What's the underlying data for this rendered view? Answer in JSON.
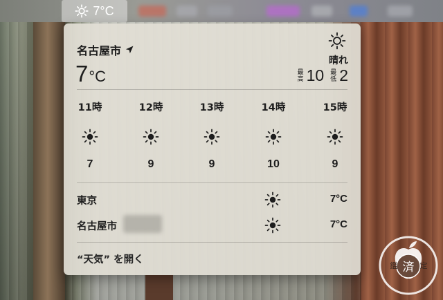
{
  "menubar": {
    "weather_temp": "7°C",
    "weather_icon": "sun-icon"
  },
  "panel": {
    "city": "名古屋市",
    "location_icon": "location-arrow-icon",
    "current_temp": "7",
    "current_unit": "°C",
    "condition": "晴れ",
    "condition_icon": "sun-icon",
    "high_label": [
      "最",
      "高"
    ],
    "high": "10",
    "low_label": [
      "最",
      "低"
    ],
    "low": "2",
    "hourly": [
      {
        "time": "11時",
        "icon": "sun-icon",
        "temp": "7"
      },
      {
        "time": "12時",
        "icon": "sun-icon",
        "temp": "9"
      },
      {
        "time": "13時",
        "icon": "sun-icon",
        "temp": "9"
      },
      {
        "time": "14時",
        "icon": "sun-icon",
        "temp": "10"
      },
      {
        "time": "15時",
        "icon": "sun-icon",
        "temp": "9"
      }
    ],
    "locations": [
      {
        "name": "東京",
        "icon": "sun-icon",
        "temp": "7°C"
      },
      {
        "name": "名古屋市",
        "icon": "sun-icon",
        "temp": "7°C"
      }
    ],
    "open_app": "“天気” を開く"
  },
  "watermark": {
    "text_left": "鑑",
    "text_mid": "済",
    "text_right": "定"
  },
  "colors": {
    "panel_bg": "#e1ded4",
    "text": "#1d1d1d"
  }
}
